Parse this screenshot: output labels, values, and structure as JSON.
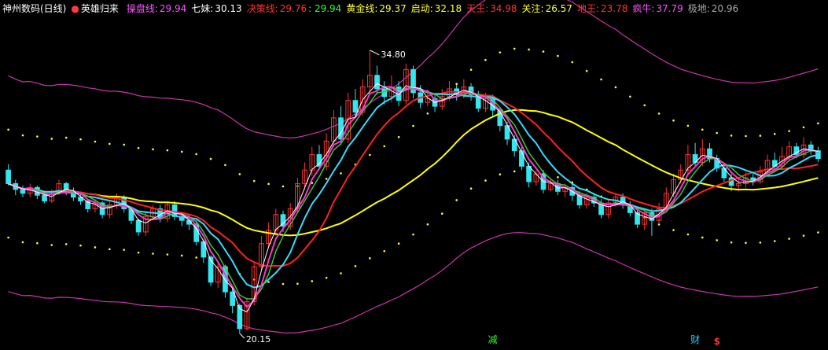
{
  "header": {
    "title": "神州数码(日线)",
    "indicator_name": "英雄归来",
    "indicator_marker": "●",
    "items": [
      {
        "label": "操盘线:",
        "value": "29.94",
        "label_color": "#ff55ff",
        "value_color": "#ff55ff"
      },
      {
        "label": "七妹:",
        "value": "30.13",
        "label_color": "#ffffff",
        "value_color": "#ffffff"
      },
      {
        "label": "决策线:",
        "value": "29.76",
        "label_color": "#ff3333",
        "value_color": "#ff3333",
        "extra": ": 29.94",
        "extra_color": "#33ff33"
      },
      {
        "label": "黄金线:",
        "value": "29.37",
        "label_color": "#ffff33",
        "value_color": "#ffff33"
      },
      {
        "label": "启动:",
        "value": "32.18",
        "label_color": "#ffff33",
        "value_color": "#ffff33"
      },
      {
        "label": "天王:",
        "value": "34.98",
        "label_color": "#ff3333",
        "value_color": "#ff3333"
      },
      {
        "label": "关注:",
        "value": "26.57",
        "label_color": "#ffff33",
        "value_color": "#ffff33"
      },
      {
        "label": "地王:",
        "value": "23.78",
        "label_color": "#ff3333",
        "value_color": "#ff3333"
      },
      {
        "label": "疯牛:",
        "value": "37.79",
        "label_color": "#ff55ff",
        "value_color": "#ff55ff"
      },
      {
        "label": "极地:",
        "value": "20.96",
        "label_color": "#aaaaaa",
        "value_color": "#aaaaaa"
      }
    ]
  },
  "annotations": {
    "high_label": "34.80",
    "low_label": "20.15",
    "marker_jian": "减",
    "marker_cai": "财",
    "marker_dollar": "$"
  },
  "colors": {
    "background": "#000000",
    "up_candle": "#ff3333",
    "down_candle": "#33e6f0",
    "ma_yellow": "#ffff00",
    "ma_red": "#ff2020",
    "ma_cyan": "#33ddff",
    "ma_white": "#ffffff",
    "ma_magenta": "#ff33cc",
    "ma_green": "#33cc33",
    "band_outer": "#cc33aa",
    "band_dots": "#ffff33"
  },
  "chart_data": {
    "type": "candlestick",
    "price_range": [
      19.5,
      36.5
    ],
    "high": 34.8,
    "low": 20.15,
    "candles": [
      [
        28.6,
        27.9,
        28.9,
        27.8
      ],
      [
        27.9,
        27.6,
        28.1,
        27.3
      ],
      [
        27.6,
        27.4,
        27.8,
        27.2
      ],
      [
        27.4,
        27.7,
        27.9,
        27.2
      ],
      [
        27.7,
        27.3,
        27.8,
        27.1
      ],
      [
        27.3,
        27.0,
        27.5,
        26.9
      ],
      [
        27.0,
        27.4,
        27.6,
        26.9
      ],
      [
        27.4,
        27.9,
        28.1,
        27.3
      ],
      [
        27.9,
        27.5,
        28.0,
        27.3
      ],
      [
        27.5,
        27.2,
        27.7,
        27.0
      ],
      [
        27.2,
        27.0,
        27.4,
        26.8
      ],
      [
        27.0,
        26.6,
        27.1,
        26.4
      ],
      [
        26.6,
        26.9,
        27.1,
        26.4
      ],
      [
        26.9,
        26.3,
        27.0,
        26.1
      ],
      [
        26.3,
        26.8,
        27.0,
        26.1
      ],
      [
        26.8,
        27.2,
        27.4,
        26.6
      ],
      [
        27.2,
        26.6,
        27.3,
        26.4
      ],
      [
        26.6,
        26.0,
        26.7,
        25.8
      ],
      [
        26.0,
        25.4,
        26.1,
        25.2
      ],
      [
        25.4,
        26.2,
        26.5,
        25.2
      ],
      [
        26.2,
        26.6,
        26.8,
        26.0
      ],
      [
        26.6,
        26.1,
        26.8,
        25.9
      ],
      [
        26.1,
        26.8,
        27.0,
        25.9
      ],
      [
        26.8,
        26.2,
        27.0,
        26.0
      ],
      [
        26.2,
        26.0,
        26.4,
        25.7
      ],
      [
        26.0,
        25.8,
        26.3,
        25.5
      ],
      [
        25.8,
        24.9,
        26.0,
        24.7
      ],
      [
        24.9,
        24.1,
        25.0,
        23.8
      ],
      [
        24.1,
        22.8,
        24.2,
        22.6
      ],
      [
        22.8,
        23.6,
        23.9,
        22.5
      ],
      [
        23.6,
        22.3,
        23.7,
        22.0
      ],
      [
        22.3,
        21.6,
        22.5,
        21.2
      ],
      [
        21.6,
        20.4,
        21.7,
        20.15
      ],
      [
        20.4,
        21.8,
        22.0,
        20.3
      ],
      [
        21.8,
        23.6,
        23.8,
        21.6
      ],
      [
        23.6,
        24.8,
        25.2,
        23.4
      ],
      [
        24.8,
        25.5,
        25.9,
        24.6
      ],
      [
        25.5,
        26.3,
        26.6,
        25.2
      ],
      [
        26.3,
        25.7,
        26.5,
        25.4
      ],
      [
        25.7,
        26.6,
        26.9,
        25.5
      ],
      [
        26.6,
        27.9,
        28.2,
        26.4
      ],
      [
        27.9,
        28.6,
        29.0,
        27.6
      ],
      [
        28.6,
        29.4,
        29.8,
        28.3
      ],
      [
        29.4,
        28.8,
        29.9,
        28.6
      ],
      [
        28.8,
        30.1,
        30.5,
        28.6
      ],
      [
        30.1,
        31.3,
        31.7,
        29.8
      ],
      [
        31.3,
        30.2,
        31.9,
        29.9
      ],
      [
        30.2,
        32.2,
        32.6,
        30.0
      ],
      [
        32.2,
        31.6,
        32.8,
        31.3
      ],
      [
        31.6,
        32.9,
        33.3,
        31.4
      ],
      [
        32.9,
        33.5,
        34.8,
        32.6
      ],
      [
        33.5,
        32.8,
        34.0,
        32.5
      ],
      [
        32.8,
        32.4,
        33.2,
        32.0
      ],
      [
        32.4,
        32.9,
        33.5,
        32.1
      ],
      [
        32.9,
        32.2,
        33.2,
        31.9
      ],
      [
        32.2,
        33.8,
        34.1,
        32.0
      ],
      [
        33.8,
        32.6,
        34.0,
        32.3
      ],
      [
        32.6,
        32.1,
        33.0,
        31.8
      ],
      [
        32.1,
        32.3,
        32.7,
        31.9
      ],
      [
        32.3,
        31.9,
        32.6,
        31.6
      ],
      [
        31.9,
        32.4,
        32.8,
        31.7
      ],
      [
        32.4,
        32.8,
        33.2,
        32.2
      ],
      [
        32.8,
        32.5,
        33.0,
        32.2
      ],
      [
        32.5,
        32.9,
        33.3,
        32.3
      ],
      [
        32.9,
        32.5,
        33.1,
        32.2
      ],
      [
        32.5,
        31.8,
        32.7,
        31.6
      ],
      [
        31.8,
        32.3,
        32.6,
        31.6
      ],
      [
        32.3,
        31.7,
        32.5,
        31.4
      ],
      [
        31.7,
        30.9,
        31.8,
        30.6
      ],
      [
        30.9,
        30.2,
        31.1,
        29.9
      ],
      [
        30.2,
        29.6,
        30.4,
        29.3
      ],
      [
        29.6,
        28.8,
        29.8,
        28.6
      ],
      [
        28.8,
        28.0,
        29.0,
        27.7
      ],
      [
        28.0,
        28.4,
        28.6,
        27.8
      ],
      [
        28.4,
        27.6,
        28.6,
        27.4
      ],
      [
        27.6,
        27.9,
        28.1,
        27.5
      ],
      [
        27.9,
        27.5,
        28.1,
        27.3
      ],
      [
        27.5,
        27.7,
        27.9,
        27.2
      ],
      [
        27.7,
        27.3,
        27.9,
        27.0
      ],
      [
        27.3,
        26.8,
        27.5,
        26.6
      ],
      [
        26.8,
        27.2,
        27.4,
        26.6
      ],
      [
        27.2,
        26.9,
        27.4,
        26.7
      ],
      [
        26.9,
        26.3,
        27.1,
        26.1
      ],
      [
        26.3,
        26.9,
        27.1,
        26.1
      ],
      [
        26.9,
        27.2,
        27.4,
        26.7
      ],
      [
        27.2,
        26.8,
        27.4,
        26.6
      ],
      [
        26.8,
        26.4,
        27.0,
        26.2
      ],
      [
        26.4,
        25.8,
        26.6,
        25.6
      ],
      [
        25.8,
        26.4,
        26.6,
        25.5
      ],
      [
        26.4,
        26.0,
        26.6,
        25.2
      ],
      [
        26.0,
        26.6,
        26.9,
        25.8
      ],
      [
        26.6,
        27.4,
        27.7,
        26.4
      ],
      [
        27.4,
        28.1,
        28.4,
        27.2
      ],
      [
        28.1,
        28.6,
        28.9,
        27.9
      ],
      [
        28.6,
        29.4,
        29.9,
        28.4
      ],
      [
        29.4,
        29.0,
        30.0,
        28.8
      ],
      [
        29.0,
        29.7,
        30.2,
        28.8
      ],
      [
        29.7,
        29.2,
        30.0,
        29.0
      ],
      [
        29.2,
        28.7,
        29.4,
        28.5
      ],
      [
        28.7,
        28.2,
        28.9,
        28.0
      ],
      [
        28.2,
        27.8,
        28.4,
        27.5
      ],
      [
        27.8,
        27.9,
        28.2,
        27.5
      ],
      [
        27.9,
        28.2,
        28.5,
        27.7
      ],
      [
        28.2,
        28.0,
        28.4,
        27.8
      ],
      [
        28.0,
        28.5,
        28.8,
        27.9
      ],
      [
        28.5,
        29.1,
        29.4,
        28.3
      ],
      [
        29.1,
        28.8,
        29.5,
        28.6
      ],
      [
        28.8,
        29.3,
        29.8,
        28.6
      ],
      [
        29.3,
        29.8,
        30.1,
        29.1
      ],
      [
        29.8,
        29.4,
        30.0,
        29.2
      ],
      [
        29.4,
        29.9,
        30.3,
        29.2
      ],
      [
        29.9,
        29.6,
        30.1,
        29.4
      ],
      [
        29.6,
        29.2,
        29.8,
        29.0
      ]
    ]
  }
}
